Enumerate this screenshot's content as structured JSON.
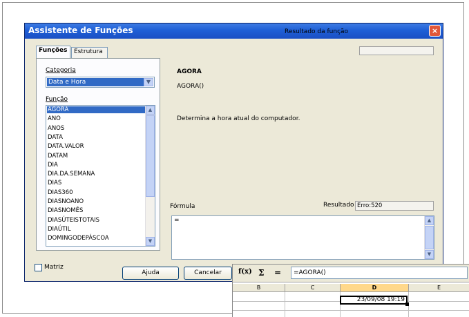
{
  "dialog": {
    "title": "Assistente de Funções",
    "close": "×",
    "tabs": [
      {
        "label": "Funções"
      },
      {
        "label": "Estrutura"
      }
    ],
    "categoria_label": "Categoria",
    "categoria_value": "Data e Hora",
    "funcao_label": "Função",
    "functions": [
      "AGORA",
      "ANO",
      "ANOS",
      "DATA",
      "DATA.VALOR",
      "DATAM",
      "DIA",
      "DIA.DA.SEMANA",
      "DIAS",
      "DIAS360",
      "DIASNOANO",
      "DIASNOMÊS",
      "DIASÚTEISTOTAIS",
      "DIAÚTIL",
      "DOMINGODEPÁSCOA"
    ],
    "selected_function": "AGORA",
    "resultado_funcao_label": "Resultado da função",
    "resultado_funcao_value": "",
    "function_name": "AGORA",
    "function_syntax": "AGORA()",
    "function_description": "Determina a hora atual do computador.",
    "formula_label": "Fórmula",
    "formula_value": "=",
    "resultado_label": "Resultado",
    "resultado_value": "Erro:520",
    "matriz_label": "Matriz",
    "buttons": {
      "ajuda": "Ajuda",
      "cancelar": "Cancelar"
    }
  },
  "spreadsheet": {
    "fx_icon": "f(x)",
    "sum_icon": "Σ",
    "equals_icon": "=",
    "formula": "=AGORA()",
    "columns": [
      "B",
      "C",
      "D",
      "E"
    ],
    "active_column": "D",
    "cell_value": "23/09/08 19:19"
  },
  "colors": {
    "titlebar": "#1f5fd6",
    "selection": "#316ac5",
    "dialog_bg": "#ece9d8",
    "close_button": "#e1573a",
    "active_col_header": "#ffd88a"
  }
}
